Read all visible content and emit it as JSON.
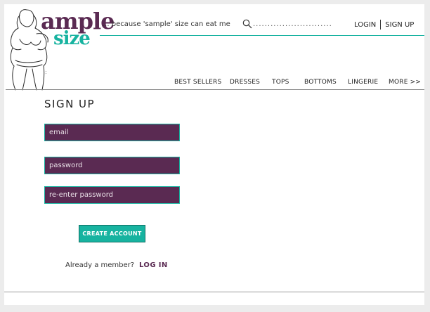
{
  "brand": {
    "word1": "ample",
    "word2": "size",
    "tagline": "... because 'sample' size can eat me",
    "purple": "#5a2a52",
    "teal": "#17b3a0"
  },
  "search": {
    "icon": "search-icon",
    "placeholder": "..........................."
  },
  "auth": {
    "login_label": "LOGIN",
    "signup_label": "SIGN UP"
  },
  "small_mark": ":",
  "nav": {
    "items": [
      {
        "label": "BEST SELLERS"
      },
      {
        "label": "DRESSES"
      },
      {
        "label": "TOPS"
      },
      {
        "label": "BOTTOMS"
      },
      {
        "label": "LINGERIE"
      },
      {
        "label": "MORE >>"
      }
    ]
  },
  "form": {
    "title": "SIGN UP",
    "email_placeholder": "email",
    "password_placeholder": "password",
    "reenter_placeholder": "re-enter password",
    "create_label": "CREATE ACCOUNT",
    "already_text": "Already a member?",
    "login_link": "LOG IN"
  }
}
